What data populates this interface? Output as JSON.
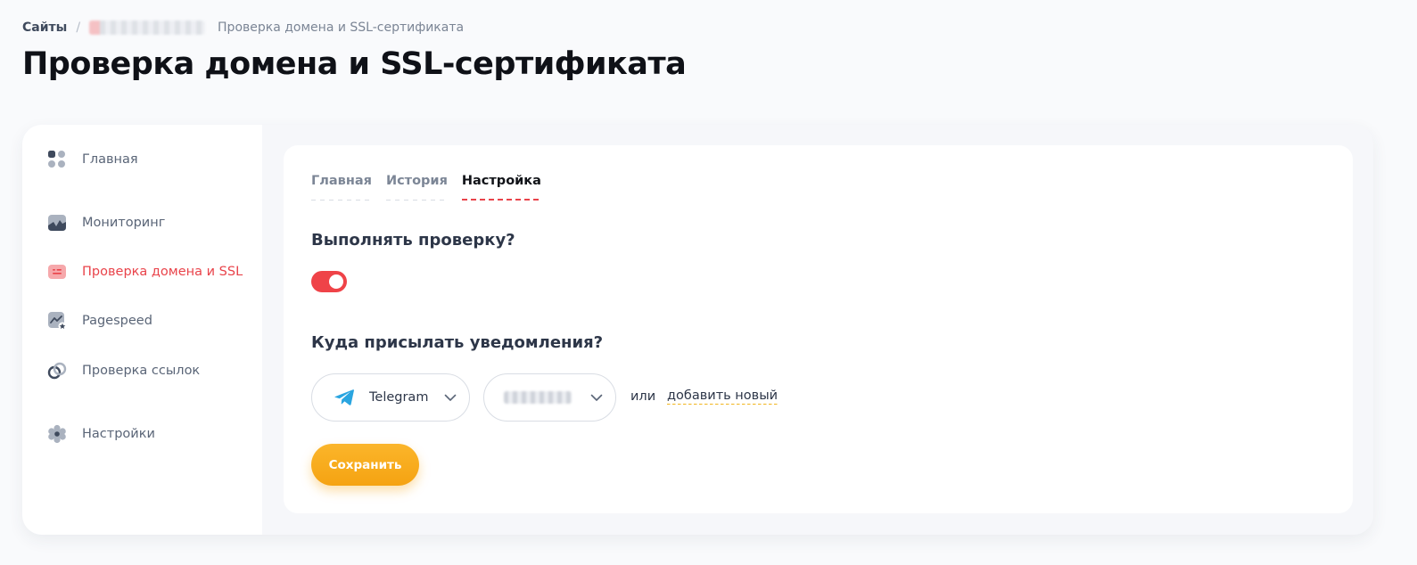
{
  "breadcrumb": {
    "root": "Сайты",
    "separator": "/",
    "current": "Проверка домена и SSL-сертификата"
  },
  "page_title": "Проверка домена и SSL-сертификата",
  "sidebar": {
    "items": [
      {
        "label": "Главная",
        "icon": "dashboard-grid-icon",
        "active": false
      },
      {
        "label": "Мониторинг",
        "icon": "monitoring-chart-icon",
        "active": false
      },
      {
        "label": "Проверка домена и SSL",
        "icon": "ssl-certificate-icon",
        "active": true
      },
      {
        "label": "Pagespeed",
        "icon": "pagespeed-chart-icon",
        "active": false
      },
      {
        "label": "Проверка ссылок",
        "icon": "link-icon",
        "active": false
      },
      {
        "label": "Настройки",
        "icon": "gear-icon",
        "active": false
      }
    ]
  },
  "tabs": [
    {
      "label": "Главная",
      "active": false
    },
    {
      "label": "История",
      "active": false
    },
    {
      "label": "Настройка",
      "active": true
    }
  ],
  "check_section": {
    "title": "Выполнять проверку?",
    "toggle_on": true
  },
  "notify_section": {
    "title": "Куда присылать уведомления?",
    "channel_select": {
      "value": "Telegram",
      "icon": "telegram-icon"
    },
    "or_text": "или",
    "add_new_link": "добавить новый"
  },
  "save_button": "Сохранить",
  "colors": {
    "accent_red": "#e9434a",
    "toggle_red": "#ef4348",
    "save_orange": "#f7a81a",
    "link_underline_yellow": "#f1b51f",
    "background": "#f9fafc"
  }
}
